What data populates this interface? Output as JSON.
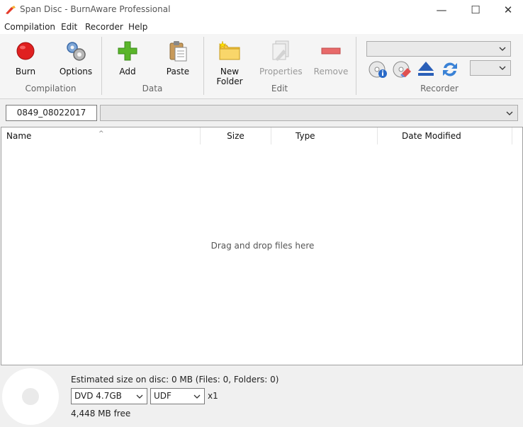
{
  "window": {
    "title": "Span Disc - BurnAware Professional",
    "minimize_glyph": "—",
    "maximize_glyph": "☐",
    "close_glyph": "✕"
  },
  "menu": [
    "Compilation",
    "Edit",
    "Recorder",
    "Help"
  ],
  "ribbon": {
    "compilation": {
      "group_label": "Compilation",
      "burn": "Burn",
      "options": "Options"
    },
    "data": {
      "group_label": "Data",
      "add": "Add",
      "paste": "Paste"
    },
    "edit": {
      "group_label": "Edit",
      "new_folder": "New Folder",
      "properties": "Properties",
      "remove": "Remove"
    },
    "recorder": {
      "group_label": "Recorder"
    }
  },
  "icons": {
    "burn": "burn-record-icon",
    "options": "gears-icon",
    "add": "add-plus-icon",
    "paste": "paste-clipboard-icon",
    "new_folder": "new-folder-icon",
    "properties": "properties-icon",
    "remove": "remove-minus-icon",
    "disc_info": "disc-info-icon",
    "erase": "disc-erase-icon",
    "eject": "eject-icon",
    "refresh": "refresh-icon"
  },
  "colors": {
    "burn_red": "#e02020",
    "add_green": "#5ab52a",
    "remove_red": "#e86a6a",
    "eject_blue": "#2a5fb8",
    "folder_yellow": "#f4c542"
  },
  "path": {
    "disc_name": "0849_08022017",
    "current_path": ""
  },
  "columns": [
    "Name",
    "Size",
    "Type",
    "Date Modified"
  ],
  "list": {
    "empty_message": "Drag and drop files here"
  },
  "status": {
    "estimated": "Estimated size on disc: 0 MB (Files: 0, Folders: 0)",
    "disc_type": "DVD 4.7GB",
    "filesystem": "UDF",
    "speed": "x1",
    "free_space": "4,448 MB free"
  }
}
